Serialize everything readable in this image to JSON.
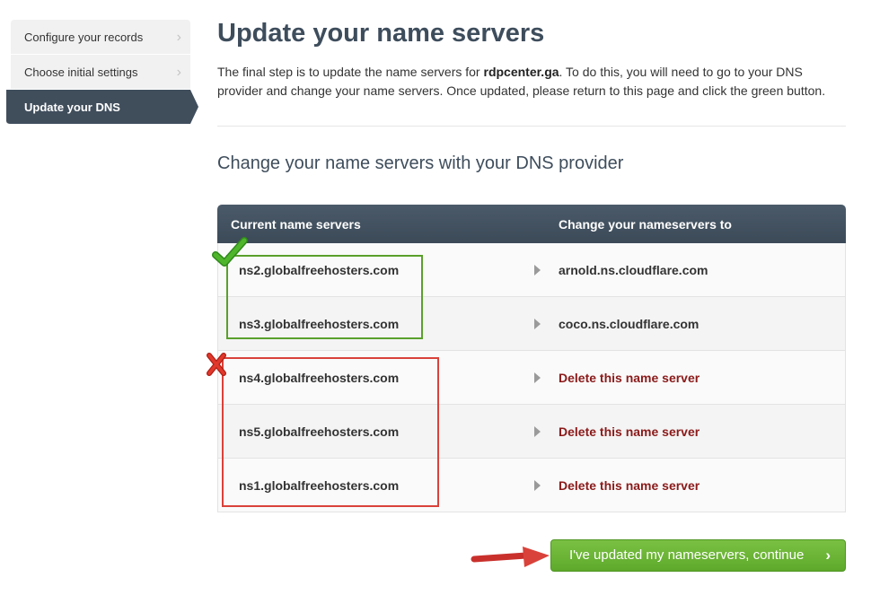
{
  "sidebar": {
    "items": [
      {
        "label": "Configure your records"
      },
      {
        "label": "Choose initial settings"
      },
      {
        "label": "Update your DNS"
      }
    ]
  },
  "main": {
    "title": "Update your name servers",
    "intro_prefix": "The final step is to update the name servers for ",
    "domain": "rdpcenter.ga",
    "intro_suffix": ". To do this, you will need to go to your DNS provider and change your name servers. Once updated, please return to this page and click the green button.",
    "subtitle": "Change your name servers with your DNS provider"
  },
  "table": {
    "header_current": "Current name servers",
    "header_change": "Change your nameservers to",
    "rows": [
      {
        "current": "ns2.globalfreehosters.com",
        "change": "arnold.ns.cloudflare.com"
      },
      {
        "current": "ns3.globalfreehosters.com",
        "change": "coco.ns.cloudflare.com"
      },
      {
        "current": "ns4.globalfreehosters.com",
        "change": "Delete this name server"
      },
      {
        "current": "ns5.globalfreehosters.com",
        "change": "Delete this name server"
      },
      {
        "current": "ns1.globalfreehosters.com",
        "change": "Delete this name server"
      }
    ]
  },
  "button": {
    "label": "I've updated my nameservers, continue",
    "chevron": "›"
  },
  "sidebar_chevron": "›",
  "colors": {
    "accent_dark": "#404e5c",
    "check_green": "#5aa02c",
    "delete_red": "#8b1a1a",
    "button_green": "#6cb538",
    "annotation_red": "#d9423a"
  },
  "icons": [
    "chevron-right-icon",
    "check-icon",
    "x-icon",
    "arrow-right-icon"
  ]
}
